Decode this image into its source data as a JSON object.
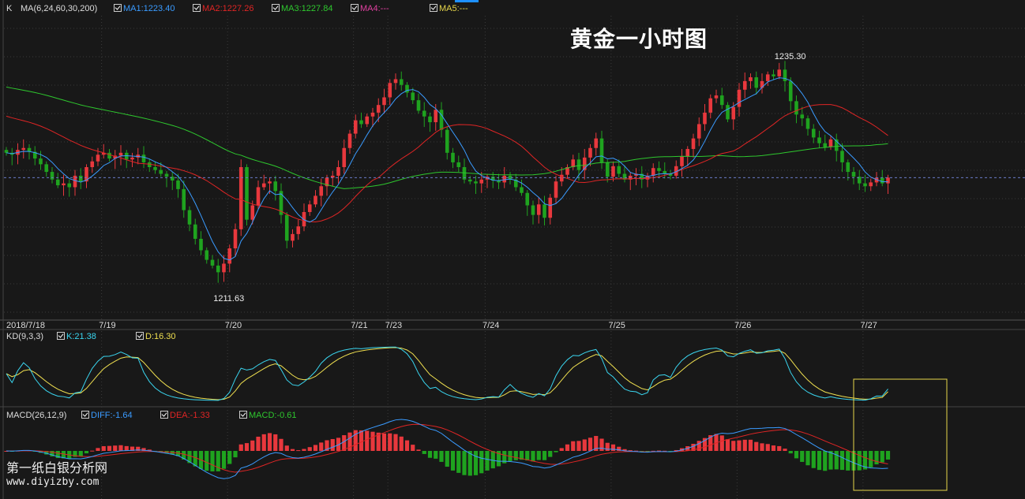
{
  "title": "黄金一小时图",
  "watermark": {
    "line1": "第一纸白银分析网",
    "line2": "www.diyizby.com"
  },
  "colors": {
    "up": "#e8383d",
    "down": "#1fa31f",
    "ma1": "#3a9bff",
    "ma2": "#e02525",
    "ma3": "#2ec72e",
    "k": "#3ad6f0",
    "d": "#f0e050",
    "grid": "#3a3a3a",
    "highlight": "#e6d64a"
  },
  "legend_main": {
    "prefix": "K",
    "ma": "MA(6,24,60,30,200)",
    "ma1": "MA1:1223.40",
    "ma2": "MA2:1227.26",
    "ma3": "MA3:1227.84",
    "ma4": "MA4:---",
    "ma5": "MA5:---"
  },
  "legend_kd": {
    "name": "KD(9,3,3)",
    "k": "K:21.38",
    "d": "D:16.30"
  },
  "legend_macd": {
    "name": "MACD(26,12,9)",
    "diff": "DIFF:-1.64",
    "dea": "DEA:-1.33",
    "macd": "MACD:-0.61"
  },
  "chart_data": {
    "type": "candlestick",
    "price_range": [
      1208.5,
      1240.5
    ],
    "annotations": [
      {
        "label": "1235.30",
        "value": 1235.3,
        "kind": "high"
      },
      {
        "label": "1211.63",
        "value": 1211.63,
        "kind": "low"
      }
    ],
    "current_price_line": 1223.4,
    "x_labels": [
      "2018/7/18",
      "7/19",
      "7/20",
      "7/21",
      "7/23",
      "7/24",
      "7/25",
      "7/26",
      "7/27"
    ],
    "x_label_bar_index": [
      0,
      17,
      39,
      61,
      67,
      84,
      106,
      128,
      150
    ],
    "close": [
      1226.0,
      1225.8,
      1226.3,
      1226.5,
      1226.1,
      1225.4,
      1224.8,
      1224.0,
      1223.2,
      1222.6,
      1222.8,
      1222.4,
      1223.6,
      1223.0,
      1224.5,
      1225.1,
      1225.8,
      1226.0,
      1225.4,
      1225.7,
      1226.0,
      1225.3,
      1225.5,
      1225.8,
      1225.0,
      1224.5,
      1224.2,
      1223.8,
      1223.5,
      1223.1,
      1222.2,
      1220.0,
      1218.5,
      1217.0,
      1215.8,
      1214.8,
      1214.2,
      1213.5,
      1214.4,
      1216.0,
      1218.0,
      1224.5,
      1219.0,
      1220.5,
      1222.4,
      1222.8,
      1223.0,
      1222.0,
      1219.5,
      1216.8,
      1217.5,
      1218.3,
      1219.8,
      1220.6,
      1221.5,
      1222.5,
      1223.4,
      1223.6,
      1224.5,
      1226.5,
      1228.0,
      1229.4,
      1229.0,
      1229.8,
      1230.2,
      1231.0,
      1231.8,
      1233.3,
      1233.7,
      1233.1,
      1232.3,
      1231.5,
      1230.4,
      1229.8,
      1229.2,
      1230.5,
      1228.4,
      1226.0,
      1225.0,
      1224.5,
      1223.2,
      1223.0,
      1222.8,
      1223.2,
      1223.5,
      1223.1,
      1222.9,
      1223.6,
      1223.2,
      1222.4,
      1221.8,
      1220.5,
      1219.5,
      1220.6,
      1219.2,
      1221.3,
      1223.0,
      1223.7,
      1224.5,
      1225.3,
      1224.2,
      1225.5,
      1226.5,
      1227.5,
      1225.0,
      1223.5,
      1224.6,
      1223.8,
      1223.2,
      1223.6,
      1223.8,
      1223.2,
      1223.6,
      1224.4,
      1224.1,
      1223.8,
      1223.6,
      1224.6,
      1225.6,
      1226.4,
      1227.5,
      1229.0,
      1230.2,
      1231.7,
      1232.0,
      1231.0,
      1229.5,
      1230.8,
      1232.6,
      1233.5,
      1233.9,
      1232.8,
      1233.5,
      1234.2,
      1234.0,
      1234.7,
      1233.5,
      1231.4,
      1230.0,
      1229.6,
      1228.5,
      1227.6,
      1227.0,
      1226.6,
      1227.4,
      1226.2,
      1225.0,
      1224.0,
      1223.5,
      1222.8,
      1222.5,
      1222.9,
      1223.4,
      1222.8,
      1223.4
    ],
    "kd": {
      "k_last": 21.38,
      "d_last": 16.3
    },
    "macd": {
      "diff_last": -1.64,
      "dea_last": -1.33,
      "macd_last": -0.61
    }
  }
}
